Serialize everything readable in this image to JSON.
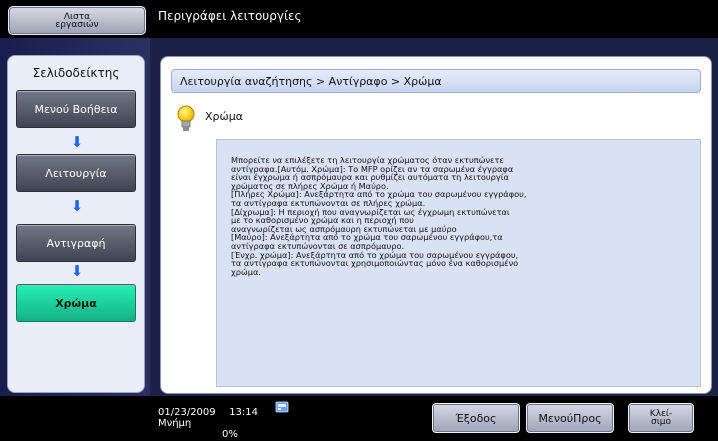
{
  "top": {
    "jobs_button_line1": "Λιστα",
    "jobs_button_line2": "εργασιών",
    "title": "Περιγράφει λειτουργίες"
  },
  "sidebar": {
    "title": "Σελιδοδείκτης",
    "items": [
      {
        "label": "Μενού Βοήθεια"
      },
      {
        "label": "Λειτουργία"
      },
      {
        "label": "Αντιγραφή"
      },
      {
        "label": "Χρώμα"
      }
    ]
  },
  "content": {
    "breadcrumb": "Λειτουργία αναζήτησης > Αντίγραφο > Χρώμα",
    "heading": "Χρώμα",
    "description": "Μπορείτε να επιλέξετε τη λειτουργία χρώματος όταν εκτυπώνετε\nαντίγραφα.[Αυτόμ. Χρώμα]: Το MFP ορίζει αν τα σαρωμένα έγγραφα\nείναι έγχρωμα ή ασπρόμαυρα και ρυθμίζει αυτόματα τη λειτουργία\nχρώματος σε πλήρες Χρώμα ή Μαύρο.\n[Πλήρες Χρώμα]: Ανεξάρτητα από το χρώμα του σαρωμένου εγγράφου,\nτα αντίγραφα εκτυπώνονται σε πλήρες χρώμα.\n[Δίχρωμα]: Η περιοχή που αναγνωρίζεται ως έγχρωμη εκτυπώνεται\nμε το καθορισμένο χρώμα και η περιοχή που\nαναγνωρίζεται ως ασπρόμαυρη εκτυπώνεται με μαύρο\n[Μαύρο]: Ανεξάρτητα από το χρώμα του σαρωμένου εγγράφου,τα\nαντίγραφα εκτυπώνονται σε ασπρόμαυρο.\n[Ένχρ. χρώμα]: Ανεξάρτητα από το χρώμα του σαρωμένου εγγράφου,\nτα αντίγραφα εκτυπώνονται χρησιμοποιώντας μόνο ένα καθορισμένο\nχρώμα."
  },
  "status": {
    "date": "01/23/2009",
    "time": "13:14",
    "memory_label": "Μνήμη",
    "memory_value": "0%"
  },
  "footer": {
    "exit": "Έξοδος",
    "menu": "ΜενούΠρος",
    "close_line1": "Κλεί-",
    "close_line2": "σιμο"
  },
  "icons": {
    "bulb": "lightbulb-icon",
    "memory": "memory-icon",
    "arrow": "arrow-down-icon"
  },
  "colors": {
    "accent_green": "#19d39f",
    "arrow_blue": "#1b63ff",
    "panel_blue": "#d9e2f5"
  }
}
